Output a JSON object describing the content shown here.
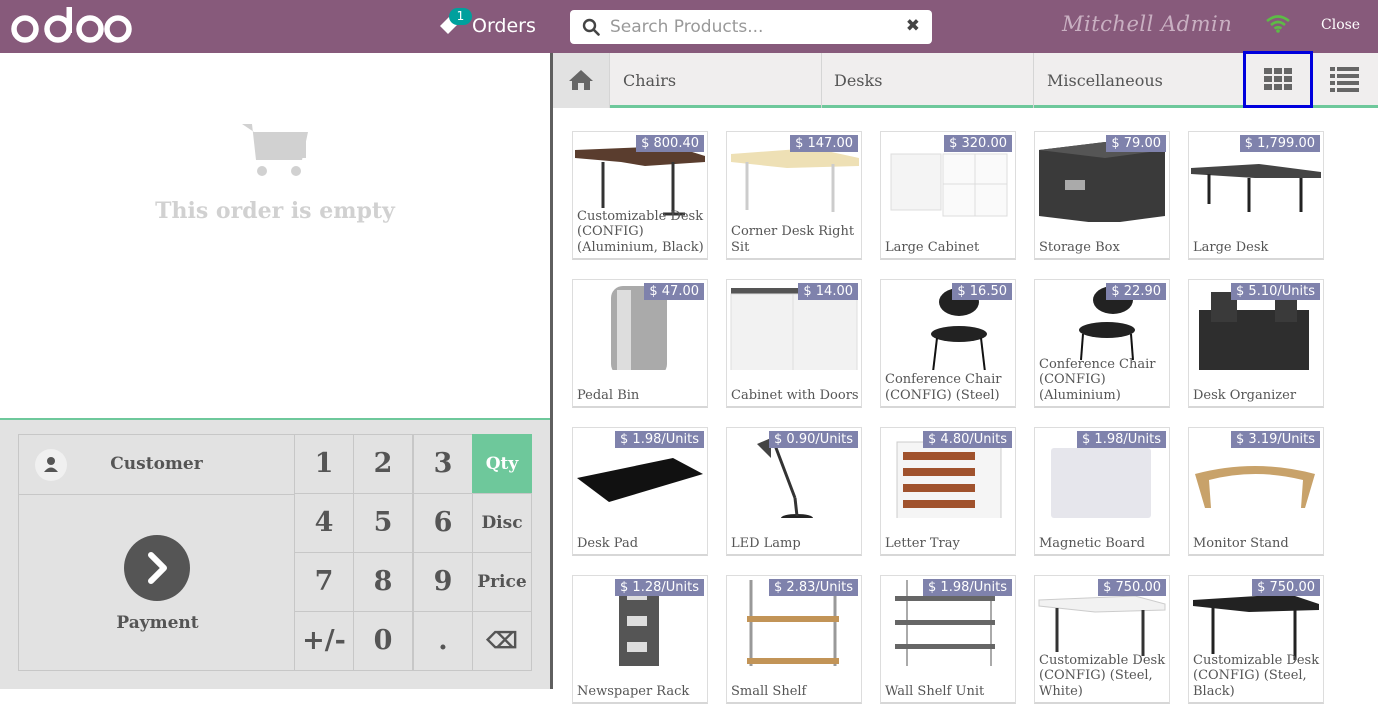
{
  "topbar": {
    "orders_label": "Orders",
    "orders_count": "1",
    "search_placeholder": "Search Products...",
    "user": "Mitchell Admin",
    "close_label": "Close"
  },
  "order": {
    "empty_message": "This order is empty"
  },
  "numpad": {
    "customer_label": "Customer",
    "payment_label": "Payment",
    "keys": [
      "1",
      "2",
      "3",
      "Qty",
      "4",
      "5",
      "6",
      "Disc",
      "7",
      "8",
      "9",
      "Price",
      "+/-",
      "0",
      ".",
      "⌫"
    ]
  },
  "categories": [
    "Chairs",
    "Desks",
    "Miscellaneous"
  ],
  "products": [
    {
      "name": "Customizable Desk (CONFIG) (Aluminium, Black)",
      "price": "$ 800.40"
    },
    {
      "name": "Corner Desk Right Sit",
      "price": "$ 147.00"
    },
    {
      "name": "Large Cabinet",
      "price": "$ 320.00"
    },
    {
      "name": "Storage Box",
      "price": "$ 79.00"
    },
    {
      "name": "Large Desk",
      "price": "$ 1,799.00"
    },
    {
      "name": "Pedal Bin",
      "price": "$ 47.00"
    },
    {
      "name": "Cabinet with Doors",
      "price": "$ 14.00"
    },
    {
      "name": "Conference Chair (CONFIG) (Steel)",
      "price": "$ 16.50"
    },
    {
      "name": "Conference Chair (CONFIG) (Aluminium)",
      "price": "$ 22.90"
    },
    {
      "name": "Desk Organizer",
      "price": "$ 5.10/Units"
    },
    {
      "name": "Desk Pad",
      "price": "$ 1.98/Units"
    },
    {
      "name": "LED Lamp",
      "price": "$ 0.90/Units"
    },
    {
      "name": "Letter Tray",
      "price": "$ 4.80/Units"
    },
    {
      "name": "Magnetic Board",
      "price": "$ 1.98/Units"
    },
    {
      "name": "Monitor Stand",
      "price": "$ 3.19/Units"
    },
    {
      "name": "Newspaper Rack",
      "price": "$ 1.28/Units"
    },
    {
      "name": "Small Shelf",
      "price": "$ 2.83/Units"
    },
    {
      "name": "Wall Shelf Unit",
      "price": "$ 1.98/Units"
    },
    {
      "name": "Customizable Desk (CONFIG) (Steel, White)",
      "price": "$ 750.00"
    },
    {
      "name": "Customizable Desk (CONFIG) (Steel, Black)",
      "price": "$ 750.00"
    }
  ]
}
